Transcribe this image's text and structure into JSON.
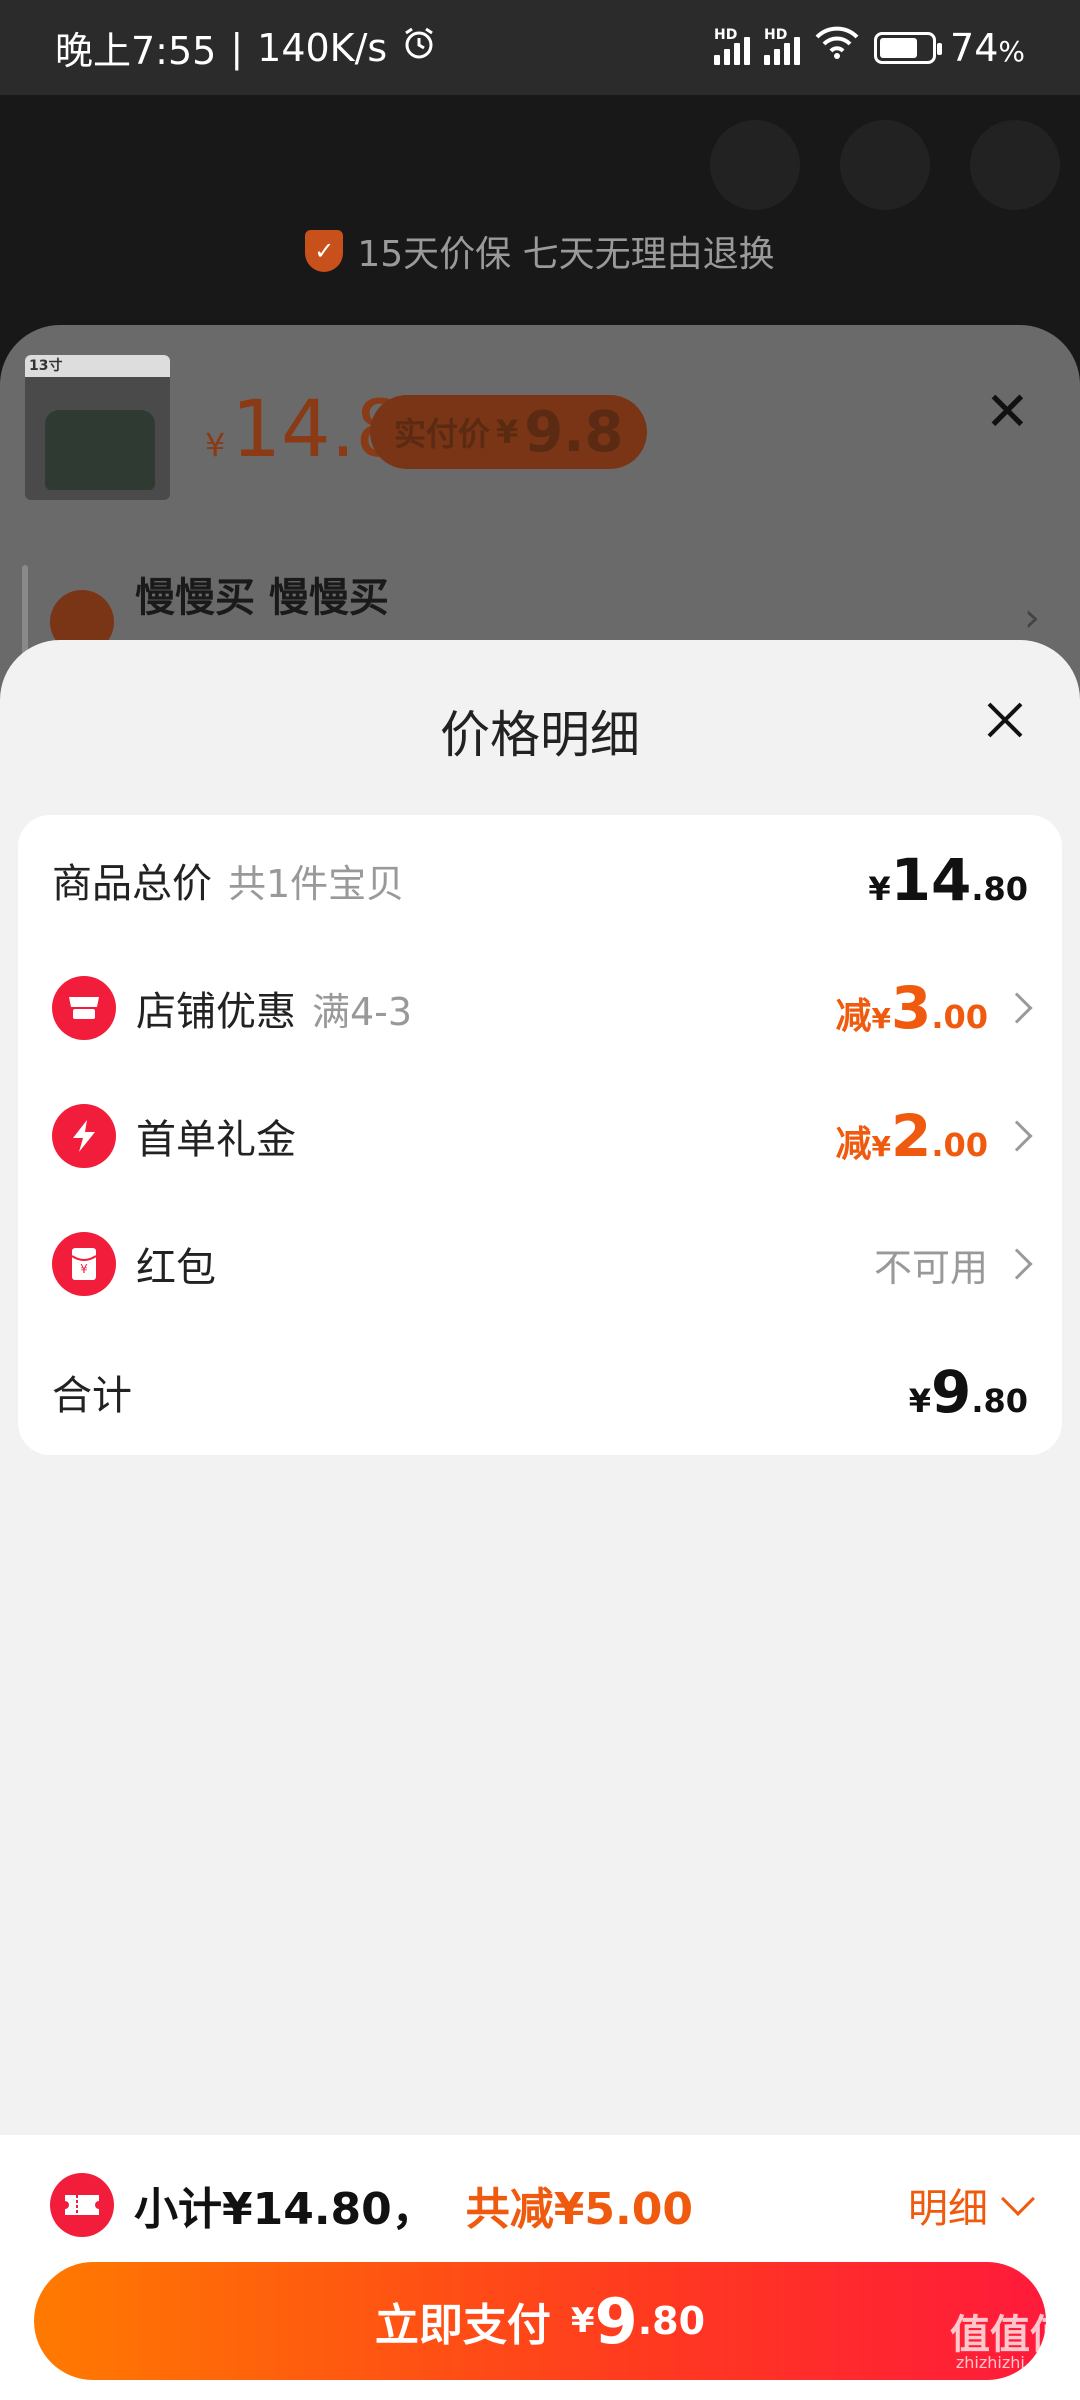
{
  "status_bar": {
    "time": "晚上7:55",
    "speed": "140K/s",
    "signal_label_1": "HD",
    "signal_label_2": "HD",
    "battery_level": 0.74,
    "battery": "74"
  },
  "background_page": {
    "guarantee_text": "15天价保 七天无理由退换"
  },
  "spec_sheet": {
    "thumb_tag": "13寸",
    "currency": "¥",
    "price": "14.8",
    "real_price_label": "实付价",
    "real_price_currency": "¥",
    "real_price": "9.8",
    "address_name": "慢慢买 慢慢买"
  },
  "price_detail": {
    "title": "价格明细",
    "rows": [
      {
        "label": "商品总价",
        "sub": "共1件宝贝",
        "currency": "¥",
        "int": "14",
        "dec": ".80"
      },
      {
        "label": "店铺优惠",
        "sub": "满4-3",
        "prefix": "减",
        "currency": "¥",
        "int": "3",
        "dec": ".00",
        "icon": "store-icon"
      },
      {
        "label": "首单礼金",
        "prefix": "减",
        "currency": "¥",
        "int": "2",
        "dec": ".00",
        "icon": "lightning-icon"
      },
      {
        "label": "红包",
        "value": "不可用",
        "icon": "red-envelope-icon"
      },
      {
        "label": "合计",
        "currency": "¥",
        "int": "9",
        "dec": ".80"
      }
    ]
  },
  "bottom_bar": {
    "subtotal": "小计¥14.80，",
    "saved": "共减¥5.00",
    "detail_link": "明细",
    "pay_label": "立即支付",
    "pay_currency": "¥",
    "pay_int": "9",
    "pay_dec": ".80"
  },
  "watermark": {
    "text": "值值值",
    "sub": "zhizhizhi.com"
  },
  "colors": {
    "accent_orange": "#f05a0e",
    "accent_red": "#f21d3a"
  }
}
